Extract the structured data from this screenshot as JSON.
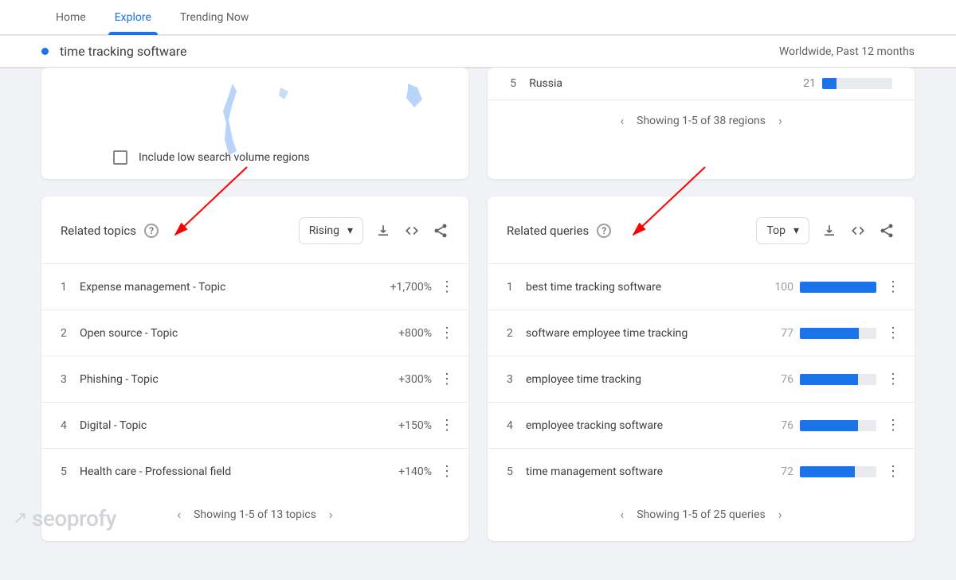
{
  "nav": {
    "items": [
      "Home",
      "Explore",
      "Trending Now"
    ],
    "activeIndex": 1
  },
  "search": {
    "term": "time tracking software",
    "filter": "Worldwide, Past 12 months"
  },
  "region": {
    "rank": "5",
    "name": "Russia",
    "value": "21",
    "barPercent": 21,
    "pagination": "Showing 1-5 of 38 regions"
  },
  "map": {
    "checkboxLabel": "Include low search volume regions"
  },
  "topics": {
    "title": "Related topics",
    "dropdown": "Rising",
    "items": [
      {
        "rank": "1",
        "text": "Expense management - Topic",
        "value": "+1,700%"
      },
      {
        "rank": "2",
        "text": "Open source - Topic",
        "value": "+800%"
      },
      {
        "rank": "3",
        "text": "Phishing - Topic",
        "value": "+300%"
      },
      {
        "rank": "4",
        "text": "Digital - Topic",
        "value": "+150%"
      },
      {
        "rank": "5",
        "text": "Health care - Professional field",
        "value": "+140%"
      }
    ],
    "pagination": "Showing 1-5 of 13 topics"
  },
  "queries": {
    "title": "Related queries",
    "dropdown": "Top",
    "items": [
      {
        "rank": "1",
        "text": "best time tracking software",
        "value": "100",
        "bar": 100
      },
      {
        "rank": "2",
        "text": "software employee time tracking",
        "value": "77",
        "bar": 77
      },
      {
        "rank": "3",
        "text": "employee time tracking",
        "value": "76",
        "bar": 76
      },
      {
        "rank": "4",
        "text": "employee tracking software",
        "value": "76",
        "bar": 76
      },
      {
        "rank": "5",
        "text": "time management software",
        "value": "72",
        "bar": 72
      }
    ],
    "pagination": "Showing 1-5 of 25 queries"
  },
  "watermark": "seoprofy"
}
